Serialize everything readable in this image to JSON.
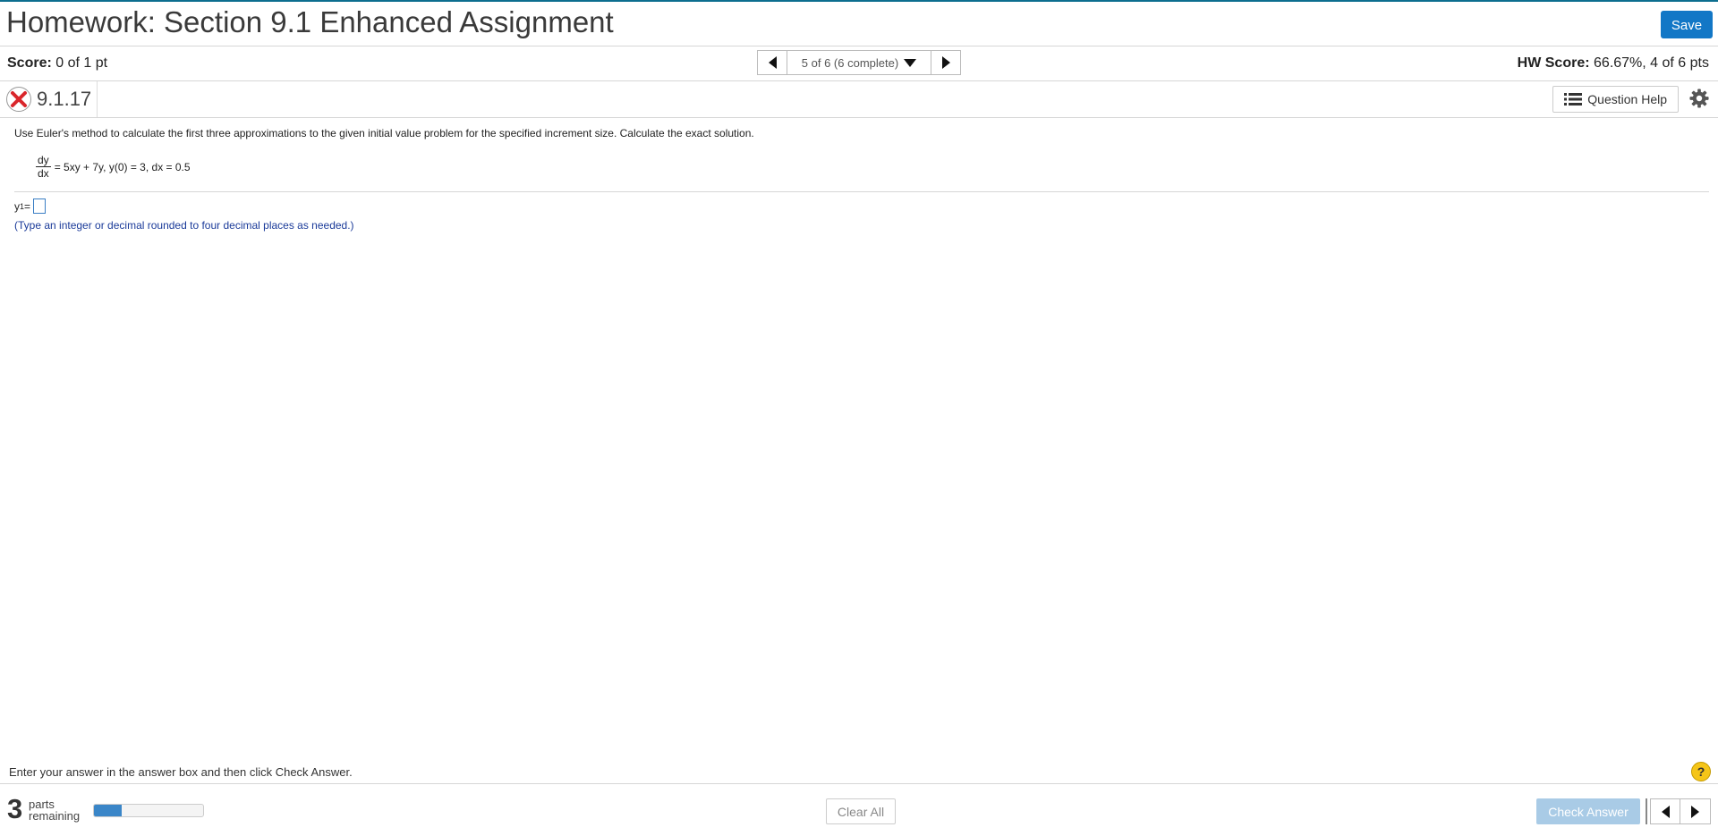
{
  "header": {
    "title": "Homework: Section 9.1 Enhanced Assignment",
    "save_label": "Save"
  },
  "scorebar": {
    "score_label": "Score:",
    "score_value": "0 of 1 pt",
    "nav_text": "5 of 6 (6 complete)",
    "hw_score_label": "HW Score:",
    "hw_score_value": "66.67%, 4 of 6 pts"
  },
  "question": {
    "number": "9.1.17",
    "help_label": "Question Help",
    "prompt": "Use Euler's method to calculate the first three approximations to the given initial value problem for the specified increment size. Calculate the exact solution.",
    "eq_num": "dy",
    "eq_den": "dx",
    "eq_rest": "= 5xy + 7y,  y(0) = 3,  dx = 0.5",
    "answer_var": "y",
    "answer_sub": "1",
    "answer_eq": " =",
    "hint": "(Type an integer or decimal rounded to four decimal places as needed.)"
  },
  "footer": {
    "instruction": "Enter your answer in the answer box and then click Check Answer.",
    "help_glyph": "?",
    "parts_count": "3",
    "parts_line1": "parts",
    "parts_line2": "remaining",
    "progress_fraction": 0.25,
    "clear_label": "Clear All",
    "check_label": "Check Answer"
  },
  "colors": {
    "accent": "#1277c6",
    "error": "#d9262b",
    "hint": "#1a3a99"
  },
  "icons": [
    "x-error-icon",
    "list-icon",
    "gear-icon",
    "chevron-left-icon",
    "chevron-right-icon",
    "dropdown-arrow-icon",
    "help-icon"
  ]
}
